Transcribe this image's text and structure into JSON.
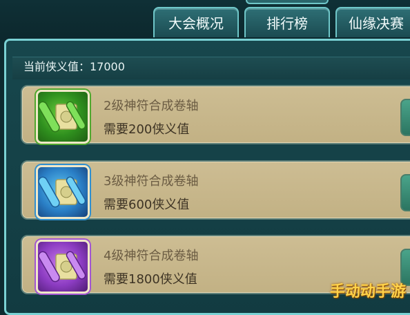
{
  "tabs": [
    {
      "label": "大会概况"
    },
    {
      "label": "排行榜"
    },
    {
      "label": "仙缘决赛"
    }
  ],
  "current_value": {
    "label": "当前侠义值：17000"
  },
  "items": [
    {
      "title": "2级神符合成卷轴",
      "requirement": "需要200侠义值",
      "icon": "green-scroll-icon",
      "color": "#3fa12a"
    },
    {
      "title": "3级神符合成卷轴",
      "requirement": "需要600侠义值",
      "icon": "blue-scroll-icon",
      "color": "#2a7fc6"
    },
    {
      "title": "4级神符合成卷轴",
      "requirement": "需要1800侠义值",
      "icon": "purple-scroll-icon",
      "color": "#8c3cc2"
    }
  ],
  "watermark": "手动动手游",
  "colors": {
    "panel_border": "#7ad2d4",
    "card_bg": "#c8b78a",
    "title_text": "#6b5c43"
  }
}
